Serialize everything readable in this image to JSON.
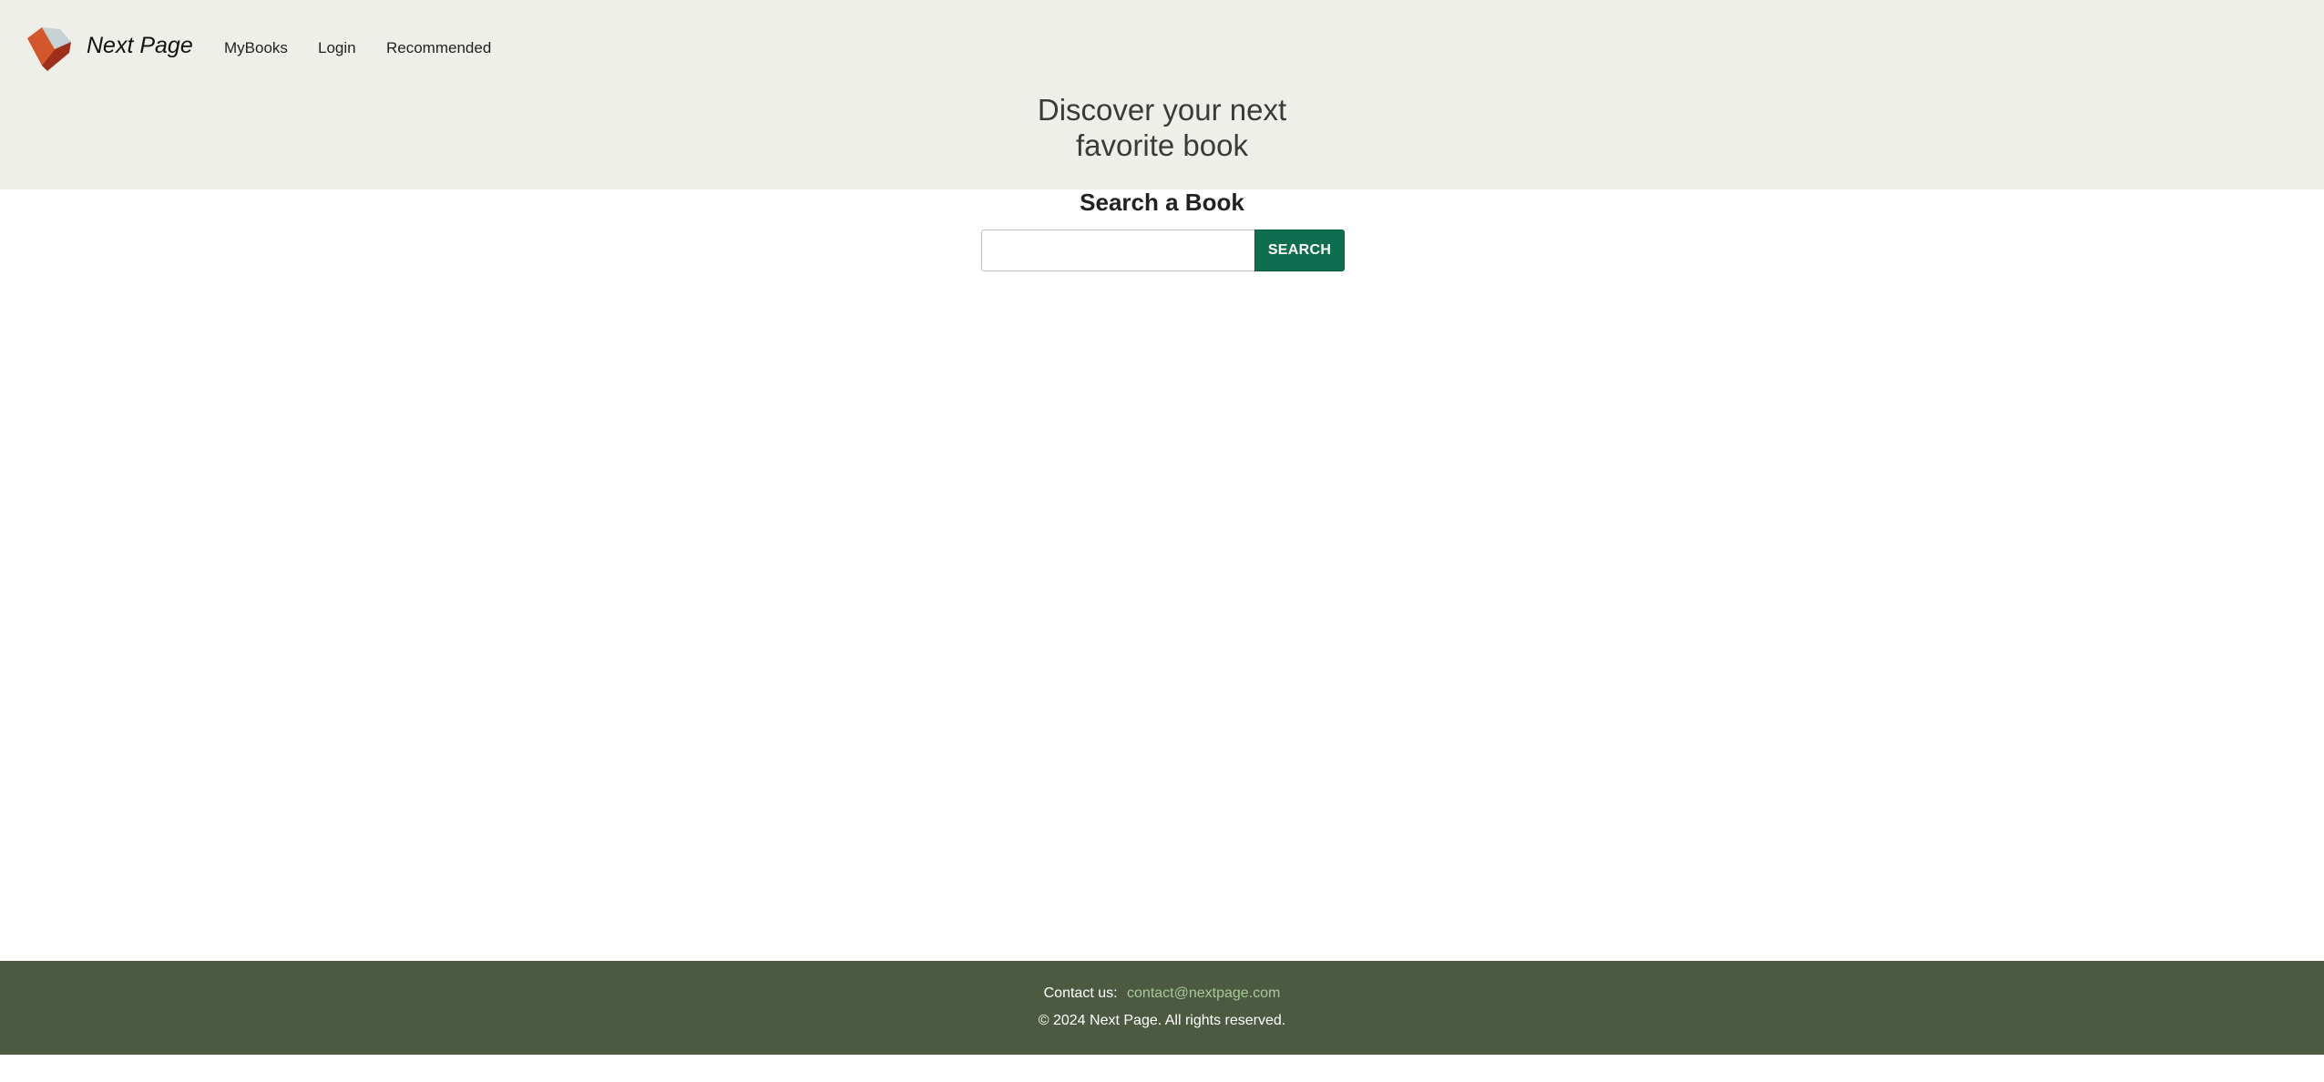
{
  "header": {
    "brand_name": "Next Page",
    "logo_icon": "cube-logo-icon",
    "nav": {
      "mybooks": "MyBooks",
      "login": "Login",
      "recommended": "Recommended"
    },
    "hero_line1": "Discover your next",
    "hero_line2": "favorite book"
  },
  "search": {
    "heading": "Search a Book",
    "input_value": "",
    "input_placeholder": "",
    "button_label": "SEARCH",
    "button_color": "#0e6e4f"
  },
  "footer": {
    "contact_label": "Contact us:",
    "contact_email": "contact@nextpage.com",
    "copyright": "© 2024 Next Page. All rights reserved.",
    "background_color": "#4b5a40"
  },
  "colors": {
    "header_background": "#efefe9",
    "logo_orange": "#d4572c",
    "logo_dark_red": "#9e2f1c",
    "logo_light_blue": "#c5d3d6"
  }
}
